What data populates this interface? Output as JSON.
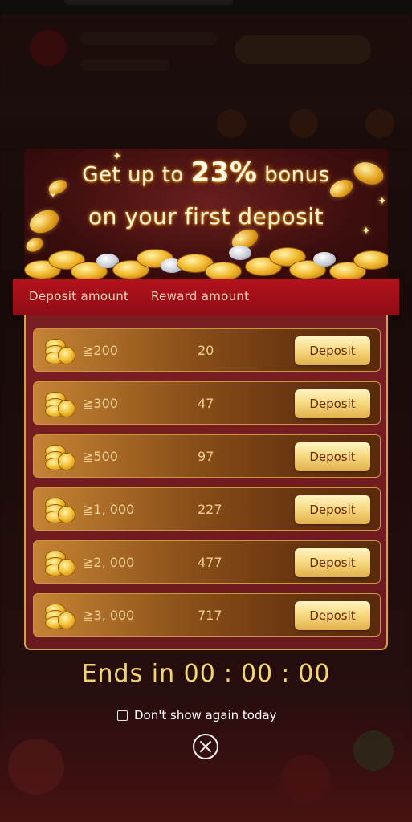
{
  "banner": {
    "line1_prefix": "Get up to ",
    "line1_percent": "23%",
    "line1_suffix": " bonus",
    "line2": "on your first deposit"
  },
  "table": {
    "col_deposit": "Deposit amount",
    "col_reward": "Reward amount",
    "rows": [
      {
        "deposit": "≧200",
        "reward": "20",
        "button": "Deposit"
      },
      {
        "deposit": "≧300",
        "reward": "47",
        "button": "Deposit"
      },
      {
        "deposit": "≧500",
        "reward": "97",
        "button": "Deposit"
      },
      {
        "deposit": "≧1, 000",
        "reward": "227",
        "button": "Deposit"
      },
      {
        "deposit": "≧2, 000",
        "reward": "477",
        "button": "Deposit"
      },
      {
        "deposit": "≧3, 000",
        "reward": "717",
        "button": "Deposit"
      }
    ]
  },
  "timer": {
    "label": "Ends in",
    "hours": "00",
    "minutes": "00",
    "seconds": "00",
    "separator": ":"
  },
  "dont_show": {
    "label": "Don't show again today",
    "checked": false
  },
  "colors": {
    "accent_gold": "#f3d56a",
    "header_red": "#b5121d",
    "panel_border": "#d2a24a"
  },
  "icons": {
    "coin_stack": "coin-stack-icon",
    "close": "close-circle-icon",
    "checkbox": "checkbox-icon"
  }
}
